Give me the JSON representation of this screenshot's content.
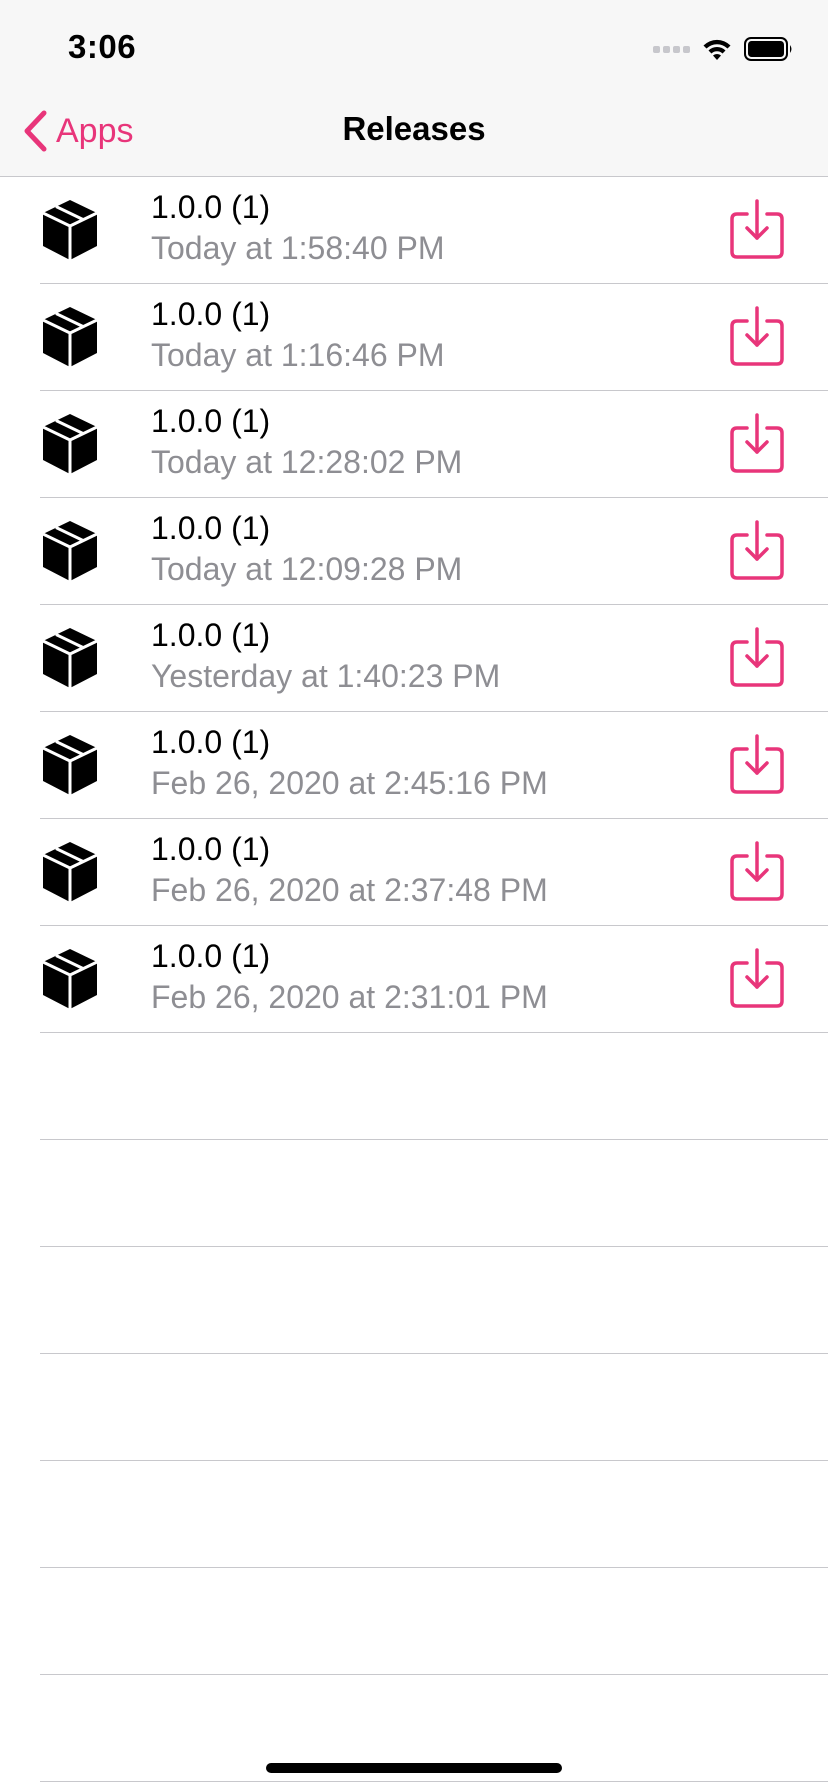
{
  "status_bar": {
    "time": "3:06",
    "wifi_icon": "wifi-icon",
    "battery_icon": "battery-icon"
  },
  "nav": {
    "back_label": "Apps",
    "title": "Releases"
  },
  "colors": {
    "accent": "#e8357a",
    "secondary_text": "#8e8e93",
    "separator": "#c8c8cc"
  },
  "releases": [
    {
      "version": "1.0.0 (1)",
      "date": "Today at 1:58:40 PM",
      "icon": "package-icon",
      "action_icon": "download-icon"
    },
    {
      "version": "1.0.0 (1)",
      "date": "Today at 1:16:46 PM",
      "icon": "package-icon",
      "action_icon": "download-icon"
    },
    {
      "version": "1.0.0 (1)",
      "date": "Today at 12:28:02 PM",
      "icon": "package-icon",
      "action_icon": "download-icon"
    },
    {
      "version": "1.0.0 (1)",
      "date": "Today at 12:09:28 PM",
      "icon": "package-icon",
      "action_icon": "download-icon"
    },
    {
      "version": "1.0.0 (1)",
      "date": "Yesterday at 1:40:23 PM",
      "icon": "package-icon",
      "action_icon": "download-icon"
    },
    {
      "version": "1.0.0 (1)",
      "date": "Feb 26, 2020 at 2:45:16 PM",
      "icon": "package-icon",
      "action_icon": "download-icon"
    },
    {
      "version": "1.0.0 (1)",
      "date": "Feb 26, 2020 at 2:37:48 PM",
      "icon": "package-icon",
      "action_icon": "download-icon"
    },
    {
      "version": "1.0.0 (1)",
      "date": "Feb 26, 2020 at 2:31:01 PM",
      "icon": "package-icon",
      "action_icon": "download-icon"
    }
  ]
}
